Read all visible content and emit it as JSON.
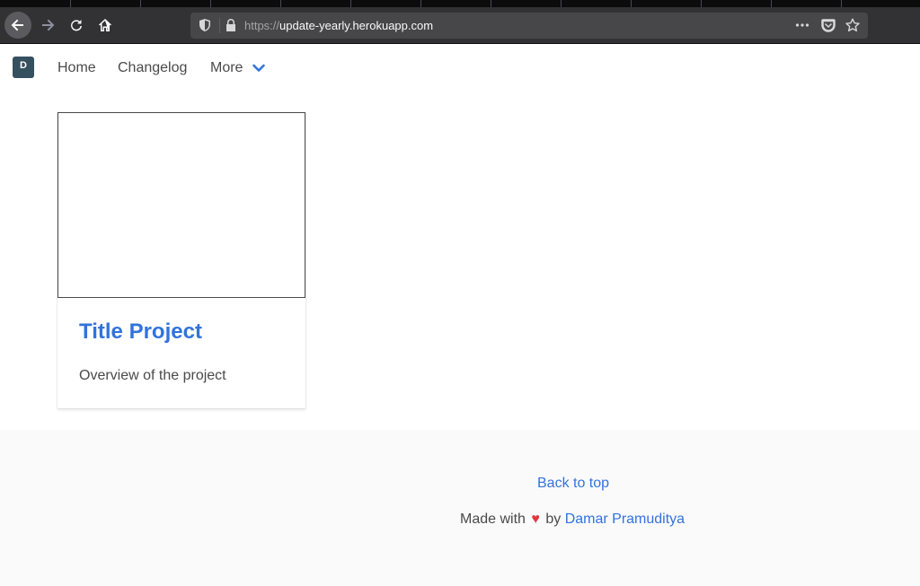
{
  "browser": {
    "url_scheme": "https://",
    "url_host": "update-yearly.herokuapp.com"
  },
  "nav": {
    "logo_letter": "D",
    "home": "Home",
    "changelog": "Changelog",
    "more": "More"
  },
  "card": {
    "title": "Title Project",
    "description": "Overview of the project"
  },
  "footer": {
    "back_to_top": "Back to top",
    "made_with": "Made with",
    "heart": "♥",
    "by": "by",
    "author": "Damar Pramuditya"
  },
  "colors": {
    "link": "#3273dc",
    "text": "#4a4a4a",
    "heart": "#e0383e",
    "logo_bg": "#35515f",
    "footer_bg": "#fafafa"
  }
}
